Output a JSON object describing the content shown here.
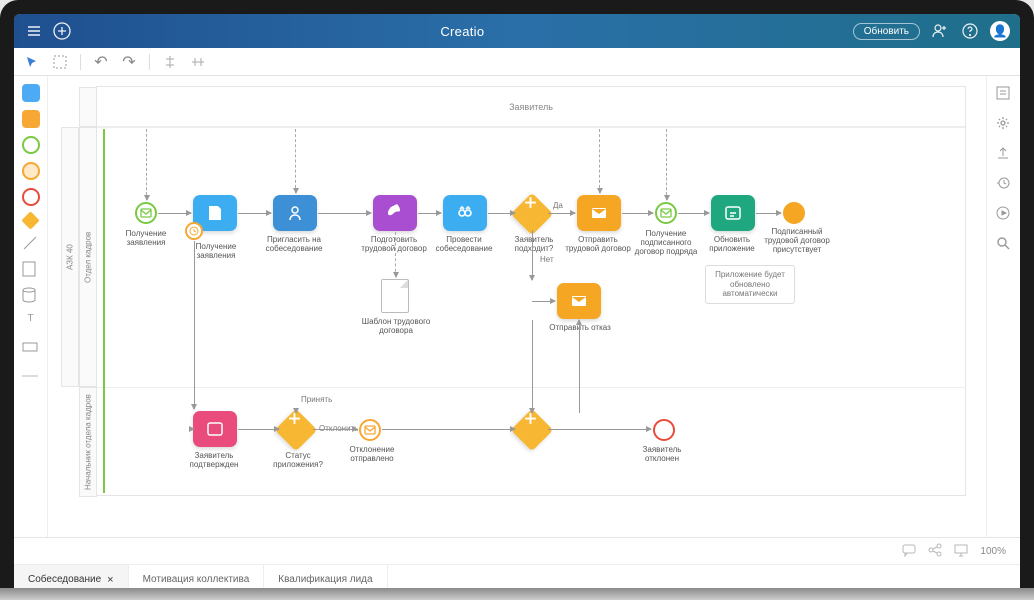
{
  "app_title": "Creatio",
  "header": {
    "update_label": "Обновить"
  },
  "pool": {
    "title": "Заявитель",
    "lanes": {
      "l2_outer": "АЗК 40",
      "l2_inner": "Отдел кадров",
      "l3": "Начальник отдела кадров"
    }
  },
  "nodes": {
    "start": "Получение заявления",
    "t1": "Получение заявления",
    "t2": "Пригласить на собеседование",
    "t3": "Подготовить трудовой договор",
    "t4": "Провести собеседование",
    "g1": "Заявитель подходит?",
    "g1_yes": "Да",
    "g1_no": "Нет",
    "t5": "Отправить трудовой договор",
    "t6": "Получение подписанного договор подряда",
    "t7": "Обновить приложение",
    "end1": "Подписанный трудовой договор присутствует",
    "doc1": "Шаблон трудового договора",
    "t8": "Отправить отказ",
    "note1": "Приложение будет обновлено автоматически",
    "t9": "Заявитель подтвержден",
    "g2": "Статус приложения?",
    "g2_accept": "Принять",
    "g2_reject": "Отклонить",
    "t10": "Отклонение отправлено",
    "end2": "Заявитель отклонен"
  },
  "tabs": [
    {
      "label": "Собеседование",
      "active": true,
      "closable": true
    },
    {
      "label": "Мотивация коллектива",
      "active": false
    },
    {
      "label": "Квалификация лида",
      "active": false
    }
  ],
  "zoom": "100%"
}
